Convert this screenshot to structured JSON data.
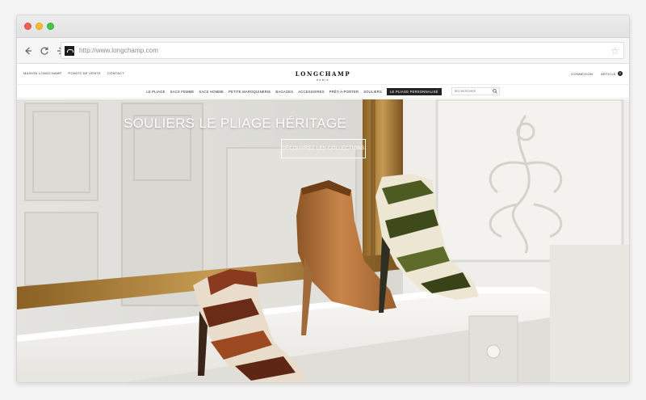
{
  "browser": {
    "url": "http://www.longchamp.com",
    "icons": {
      "back": "arrow-left-icon",
      "reload": "reload-icon",
      "forward": "arrow-right-icon",
      "bookmark": "star-icon"
    }
  },
  "site": {
    "top_links": [
      "Maison Longchamp",
      "Points de vente",
      "Contact"
    ],
    "logo": {
      "brand": "LONGCHAMP",
      "city": "PARIS"
    },
    "account": {
      "login": "Connexion",
      "bag": "Article",
      "bag_count": "0"
    },
    "nav": [
      "Le Pliage",
      "Sacs Femme",
      "Sacs Homme",
      "Petite Maroquinerie",
      "Bagages",
      "Accessoires",
      "Prêt-à-porter",
      "Souliers"
    ],
    "nav_highlight": "Le Pliage Personnalisé",
    "search_placeholder": "Rechercher"
  },
  "hero": {
    "title": "SOULIERS LE PLIAGE HÉRITAGE",
    "cta": "Découvrez les collections"
  },
  "colors": {
    "accent": "#222222",
    "wall": "#e9e8e4",
    "marble": "#f4f2ee",
    "mirror_frame": "#b68b42",
    "boot_tan": "#b5753b"
  }
}
